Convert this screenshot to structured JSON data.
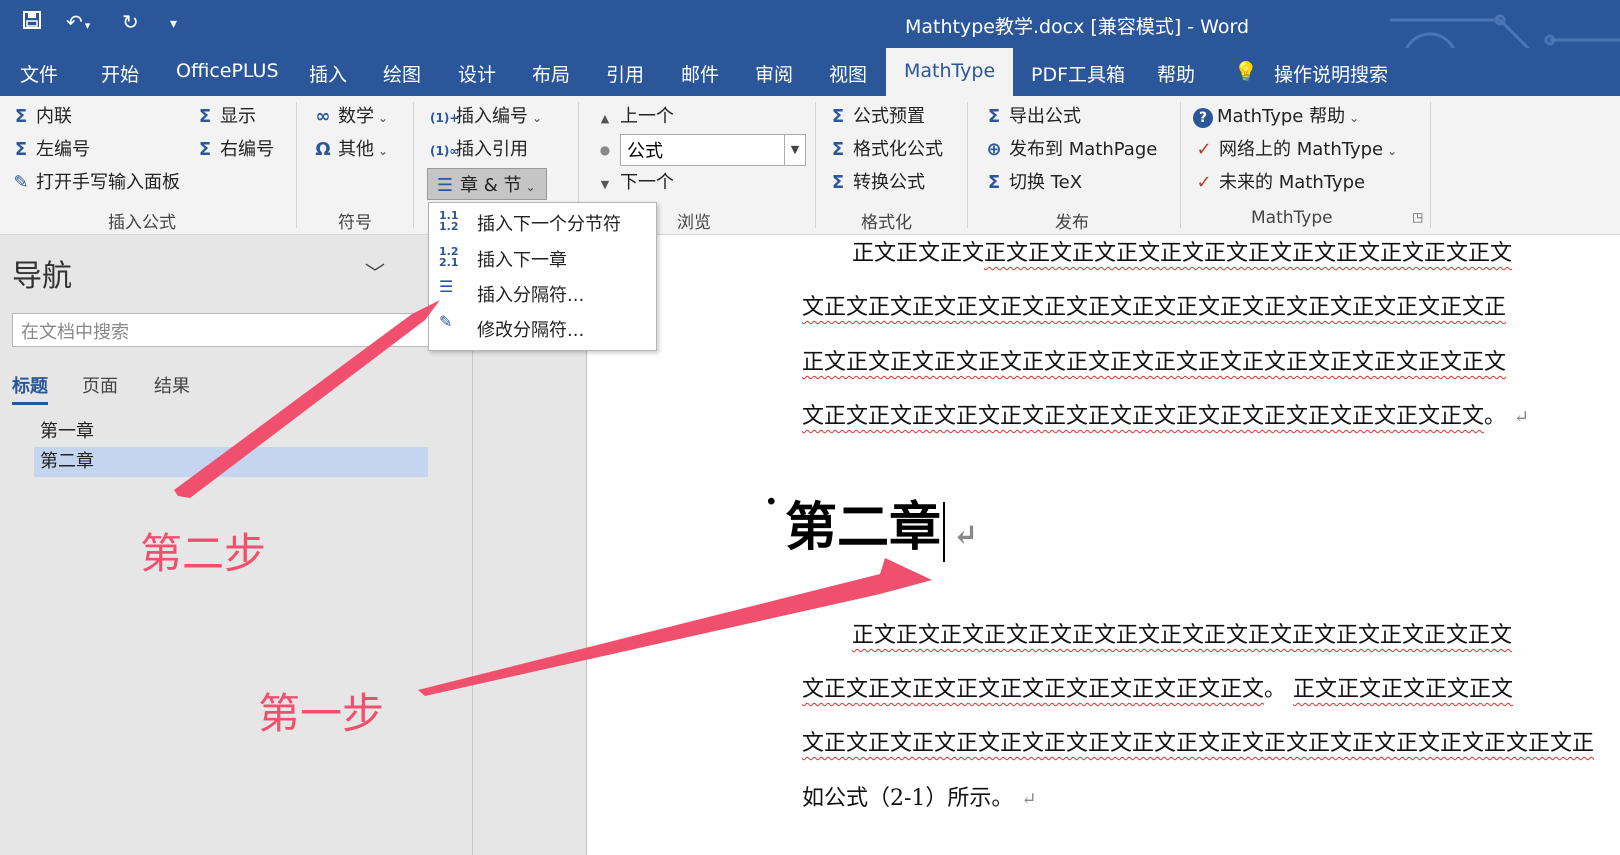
{
  "title_bar": {
    "doc_title": "Mathtype教学.docx [兼容模式]  -  Word",
    "quick_access": [
      "save",
      "undo",
      "redo",
      "customize"
    ]
  },
  "tabs": [
    "文件",
    "开始",
    "OfficePLUS",
    "插入",
    "绘图",
    "设计",
    "布局",
    "引用",
    "邮件",
    "审阅",
    "视图",
    "MathType",
    "PDF工具箱",
    "帮助",
    "操作说明搜索"
  ],
  "active_tab": "MathType",
  "ribbon": {
    "insert_formula": {
      "inline": "内联",
      "display": "显示",
      "left_number": "左编号",
      "right_number": "右编号",
      "handwriting": "打开手写输入面板",
      "group_label": "插入公式"
    },
    "symbols": {
      "math": "数学",
      "other": "其他",
      "group_label": "符号"
    },
    "numbering": {
      "insert_number": "插入编号",
      "insert_reference": "插入引用",
      "chapter_section": "章 & 节"
    },
    "browse": {
      "prev": "上一个",
      "field_value": "公式",
      "next": "下一个",
      "group_label": "浏览"
    },
    "format": {
      "presets": "公式预置",
      "format_equations": "格式化公式",
      "convert": "转换公式",
      "group_label": "格式化"
    },
    "publish": {
      "export": "导出公式",
      "mathpage": "发布到 MathPage",
      "toggle_tex": "切换 TeX",
      "group_label": "发布"
    },
    "mathtype": {
      "help": "MathType 帮助",
      "web": "网络上的 MathType",
      "future": "未来的 MathType",
      "group_label": "MathType"
    }
  },
  "dropdown": {
    "items": [
      {
        "label": "插入下一个分节符",
        "icon_text": "1.1 1.2"
      },
      {
        "label": "插入下一章",
        "icon_text": "1.2 2.1"
      },
      {
        "label": "插入分隔符...",
        "icon_text": ""
      },
      {
        "label": "修改分隔符...",
        "icon_text": ""
      }
    ]
  },
  "nav": {
    "title": "导航",
    "search_placeholder": "在文档中搜索",
    "tabs": [
      "标题",
      "页面",
      "结果"
    ],
    "headings": [
      "第一章",
      "第二章"
    ],
    "selected_heading": "第二章"
  },
  "document": {
    "para1_lines": [
      {
        "plain": "正文正文正文",
        "squiggle": "正文正文正文正文正文正文正文正文正文正文正文正文"
      },
      {
        "plain": "",
        "squiggle": "文正文正文正文正文正文正文正文正文正文正文正文正文正文正文正文正"
      },
      {
        "plain": "",
        "squiggle": "正文正文正文正文正文正文正文正文正文正文正文正文正文正文正文正文"
      },
      {
        "plain": "",
        "squiggle": "文正文正文正文正文正文正文正文正文正文正文正文正文正文正文正文",
        "tail": "。"
      }
    ],
    "heading": "第二章",
    "para2_lines": [
      {
        "plain": "",
        "squiggle": "正文正文正文正文正文正文正文正文正文正文正文正文正文正文正文"
      },
      {
        "plain": "",
        "squiggle": "文正文正文正文正文正文正文正文正文正文正文",
        "tail": "。 ",
        "squiggle2": "正文正文正文正文正文"
      },
      {
        "plain": "",
        "squiggle": "文正文正文正文正文正文正文正文正文正文正文正文正文正文正文正文正文正文正"
      },
      {
        "plain": "如公式（2-1）所示。",
        "squiggle": ""
      }
    ]
  },
  "annotations": {
    "step2": "第二步",
    "step1": "第一步",
    "color": "#f0506e"
  },
  "colors": {
    "accent": "#2b579a",
    "squiggle": "#e03030",
    "nav_selected": "#c5d5ef"
  }
}
